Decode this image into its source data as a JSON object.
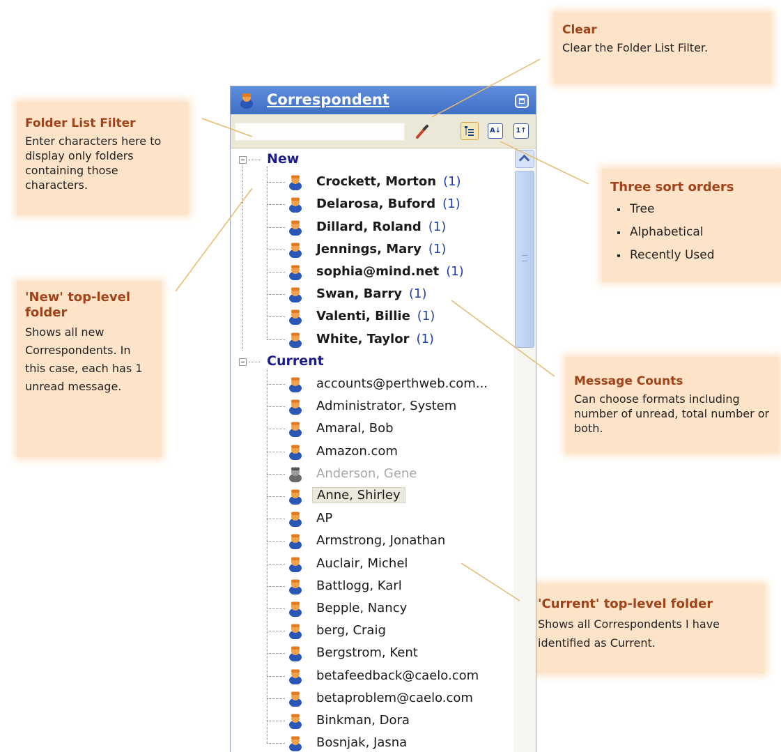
{
  "panel": {
    "title": "Correspondent",
    "filter_value": "",
    "sort_buttons": {
      "tree": "",
      "alpha": "A↓",
      "recent": "1↑"
    }
  },
  "tree": {
    "folders": [
      {
        "label": "New",
        "items": [
          {
            "name": "Crockett, Morton",
            "count": "(1)"
          },
          {
            "name": "Delarosa, Buford",
            "count": "(1)"
          },
          {
            "name": "Dillard, Roland",
            "count": "(1)"
          },
          {
            "name": "Jennings, Mary",
            "count": "(1)"
          },
          {
            "name": "sophia@mind.net",
            "count": "(1)"
          },
          {
            "name": "Swan, Barry",
            "count": "(1)"
          },
          {
            "name": "Valenti, Billie",
            "count": "(1)"
          },
          {
            "name": "White, Taylor",
            "count": "(1)"
          }
        ]
      },
      {
        "label": "Current",
        "items": [
          {
            "name": "accounts@perthweb.com..."
          },
          {
            "name": "Administrator, System"
          },
          {
            "name": "Amaral, Bob"
          },
          {
            "name": "Amazon.com"
          },
          {
            "name": "Anderson, Gene",
            "state": "inactive"
          },
          {
            "name": "Anne, Shirley",
            "state": "selected"
          },
          {
            "name": "AP"
          },
          {
            "name": "Armstrong, Jonathan"
          },
          {
            "name": "Auclair, Michel"
          },
          {
            "name": "Battlogg, Karl"
          },
          {
            "name": "Bepple, Nancy"
          },
          {
            "name": "berg, Craig"
          },
          {
            "name": "Bergstrom, Kent"
          },
          {
            "name": "betafeedback@caelo.com"
          },
          {
            "name": "betaproblem@caelo.com"
          },
          {
            "name": "Binkman, Dora"
          },
          {
            "name": "Bosnjak, Jasna"
          }
        ]
      }
    ]
  },
  "callouts": {
    "clear": {
      "title": "Clear",
      "body": "Clear the Folder List Filter."
    },
    "filter": {
      "title": "Folder List Filter",
      "body": "Enter characters here to display only folders containing those characters."
    },
    "sort": {
      "title": "Three sort orders",
      "items": [
        "Tree",
        "Alphabetical",
        "Recently Used"
      ]
    },
    "new_folder": {
      "title": "'New' top-level folder",
      "body": "Shows all new Correspondents. In this case, each has 1 unread message."
    },
    "counts": {
      "title": "Message Counts",
      "body": "Can choose formats including number of unread, total number or both."
    },
    "current_folder": {
      "title": "'Current' top-level folder",
      "body": "Shows all Correspondents I have identified as Current."
    }
  },
  "colors": {
    "callout_bg": "#fde3c8",
    "callout_title": "#a0431a",
    "titlebar": "#4a7bd0",
    "folder_label": "#1b1b8a",
    "count": "#1b3fb0"
  }
}
